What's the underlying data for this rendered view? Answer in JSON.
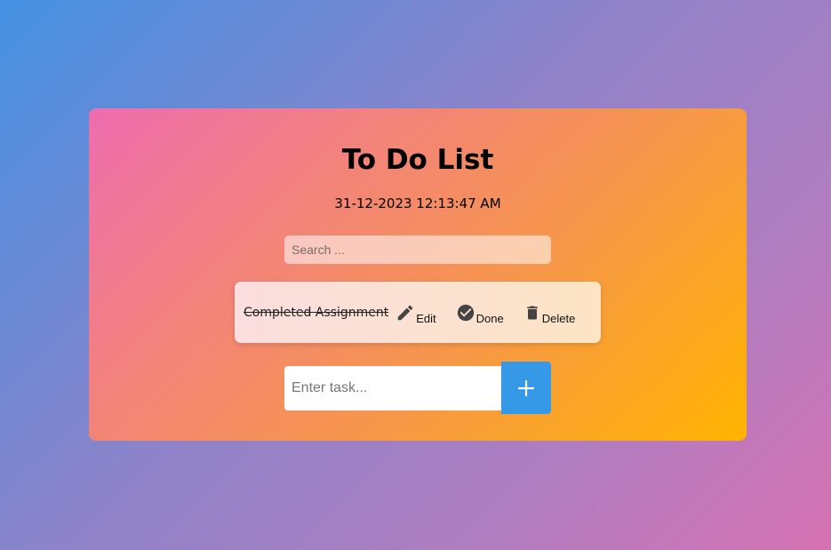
{
  "app": {
    "title": "To Do List",
    "datetime": "31-12-2023 12:13:47 AM"
  },
  "search": {
    "placeholder": "Search ...",
    "value": ""
  },
  "tasks": [
    {
      "text": "Completed Assignment",
      "completed": true,
      "actions": {
        "edit_label": "Edit",
        "edit_icon": "pencil-icon",
        "done_label": "Done",
        "done_icon": "check-circle-icon",
        "delete_label": "Delete",
        "delete_icon": "trash-icon"
      }
    }
  ],
  "add_task": {
    "placeholder": "Enter task...",
    "value": "",
    "button_icon": "plus-icon"
  },
  "colors": {
    "add_button": "#3699e8",
    "icon": "#444444"
  }
}
